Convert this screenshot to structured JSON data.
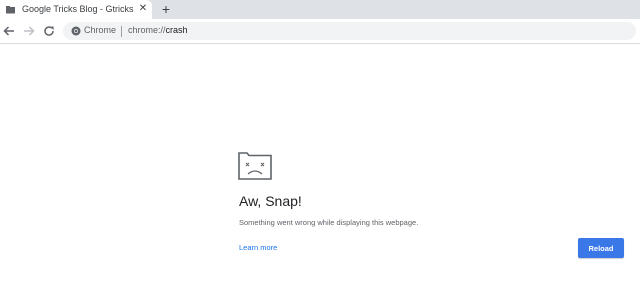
{
  "tab": {
    "title": "Google Tricks Blog - Gtricks",
    "close_glyph": "✕",
    "favicon": "folder-icon"
  },
  "new_tab_glyph": "+",
  "toolbar": {
    "back_icon": "back-arrow-icon",
    "forward_icon": "forward-arrow-icon",
    "reload_icon": "reload-icon"
  },
  "omnibox": {
    "chip_label": "Chrome",
    "url_scheme": "chrome://",
    "url_host": "crash",
    "icon": "chrome-icon"
  },
  "error": {
    "icon": "sad-folder-icon",
    "title": "Aw, Snap!",
    "message": "Something went wrong while displaying this webpage.",
    "learn_more": "Learn more",
    "reload_label": "Reload"
  },
  "colors": {
    "tabstrip_bg": "#dee1e6",
    "omnibox_bg": "#f1f3f4",
    "accent": "#3b78e7",
    "link": "#1a73e8"
  }
}
